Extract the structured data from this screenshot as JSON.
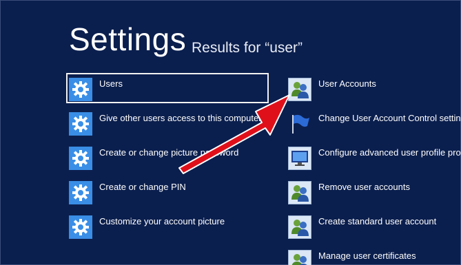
{
  "header": {
    "title": "Settings",
    "subtitle": "Results for “user”"
  },
  "settings_results": [
    {
      "label": "Users",
      "icon": "gear-icon",
      "selected": true
    },
    {
      "label": "Give other users access to this computer",
      "icon": "gear-icon"
    },
    {
      "label": "Create or change picture password",
      "icon": "gear-icon"
    },
    {
      "label": "Create or change PIN",
      "icon": "gear-icon"
    },
    {
      "label": "Customize your account picture",
      "icon": "gear-icon"
    }
  ],
  "control_panel_results": [
    {
      "label": "User Accounts",
      "icon": "user-accounts-icon"
    },
    {
      "label": "Change User Account Control settings",
      "icon": "uac-flag-icon"
    },
    {
      "label": "Configure advanced user profile properties",
      "icon": "monitor-icon"
    },
    {
      "label": "Remove user accounts",
      "icon": "user-accounts-icon"
    },
    {
      "label": "Create standard user account",
      "icon": "user-accounts-icon"
    },
    {
      "label": "Manage user certificates",
      "icon": "user-accounts-icon"
    }
  ],
  "colors": {
    "background": "#0b1f4e",
    "gear_tile": "#3a8ee6",
    "annotation_arrow": "#e0101a"
  }
}
